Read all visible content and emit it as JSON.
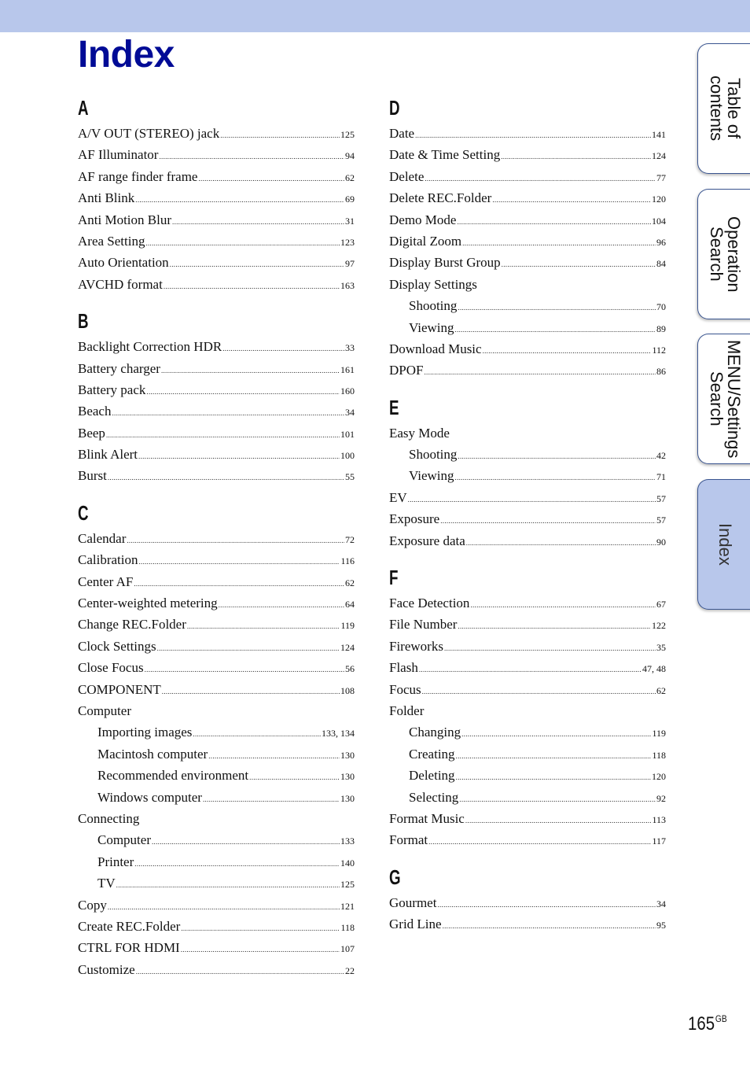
{
  "page": {
    "title": "Index",
    "page_number": "165",
    "page_suffix": "GB"
  },
  "tabs": [
    {
      "label": "Table of\ncontents",
      "active": false
    },
    {
      "label": "Operation\nSearch",
      "active": false
    },
    {
      "label": "MENU/Settings\nSearch",
      "active": false
    },
    {
      "label": "Index",
      "active": true
    }
  ],
  "left_column": [
    {
      "letter": "A",
      "entries": [
        {
          "label": "A/V OUT (STEREO) jack",
          "page": "125"
        },
        {
          "label": "AF Illuminator",
          "page": "94"
        },
        {
          "label": "AF range finder frame",
          "page": "62"
        },
        {
          "label": "Anti Blink",
          "page": "69"
        },
        {
          "label": "Anti Motion Blur",
          "page": "31"
        },
        {
          "label": "Area Setting",
          "page": "123"
        },
        {
          "label": "Auto Orientation",
          "page": "97"
        },
        {
          "label": "AVCHD format",
          "page": "163"
        }
      ]
    },
    {
      "letter": "B",
      "entries": [
        {
          "label": "Backlight Correction HDR",
          "page": "33"
        },
        {
          "label": "Battery charger",
          "page": "161"
        },
        {
          "label": "Battery pack",
          "page": "160"
        },
        {
          "label": "Beach",
          "page": "34"
        },
        {
          "label": "Beep",
          "page": "101"
        },
        {
          "label": "Blink Alert",
          "page": "100"
        },
        {
          "label": "Burst",
          "page": "55"
        }
      ]
    },
    {
      "letter": "C",
      "entries": [
        {
          "label": "Calendar",
          "page": "72"
        },
        {
          "label": "Calibration",
          "page": "116"
        },
        {
          "label": "Center AF",
          "page": "62"
        },
        {
          "label": "Center-weighted metering",
          "page": "64"
        },
        {
          "label": "Change REC.Folder",
          "page": "119"
        },
        {
          "label": "Clock Settings",
          "page": "124"
        },
        {
          "label": "Close Focus",
          "page": "56"
        },
        {
          "label": "COMPONENT",
          "page": "108"
        },
        {
          "label": "Computer",
          "page": ""
        },
        {
          "label": "Importing images",
          "page": "133, 134",
          "sub": true
        },
        {
          "label": "Macintosh computer",
          "page": "130",
          "sub": true
        },
        {
          "label": "Recommended environment",
          "page": "130",
          "sub": true
        },
        {
          "label": "Windows computer",
          "page": "130",
          "sub": true
        },
        {
          "label": "Connecting",
          "page": ""
        },
        {
          "label": "Computer",
          "page": "133",
          "sub": true
        },
        {
          "label": "Printer",
          "page": "140",
          "sub": true
        },
        {
          "label": "TV",
          "page": "125",
          "sub": true
        },
        {
          "label": "Copy",
          "page": "121"
        },
        {
          "label": "Create REC.Folder",
          "page": "118"
        },
        {
          "label": "CTRL FOR HDMI",
          "page": "107"
        },
        {
          "label": "Customize",
          "page": "22"
        }
      ]
    }
  ],
  "right_column": [
    {
      "letter": "D",
      "entries": [
        {
          "label": "Date",
          "page": "141"
        },
        {
          "label": "Date & Time Setting",
          "page": "124"
        },
        {
          "label": "Delete",
          "page": "77"
        },
        {
          "label": "Delete REC.Folder",
          "page": "120"
        },
        {
          "label": "Demo Mode",
          "page": "104"
        },
        {
          "label": "Digital Zoom",
          "page": "96"
        },
        {
          "label": "Display Burst Group",
          "page": "84"
        },
        {
          "label": "Display Settings",
          "page": ""
        },
        {
          "label": "Shooting",
          "page": "70",
          "sub": true
        },
        {
          "label": "Viewing",
          "page": "89",
          "sub": true
        },
        {
          "label": "Download Music",
          "page": "112"
        },
        {
          "label": "DPOF",
          "page": "86"
        }
      ]
    },
    {
      "letter": "E",
      "entries": [
        {
          "label": "Easy Mode",
          "page": ""
        },
        {
          "label": "Shooting",
          "page": "42",
          "sub": true
        },
        {
          "label": "Viewing",
          "page": "71",
          "sub": true
        },
        {
          "label": "EV",
          "page": "57"
        },
        {
          "label": "Exposure",
          "page": "57"
        },
        {
          "label": "Exposure data",
          "page": "90"
        }
      ]
    },
    {
      "letter": "F",
      "entries": [
        {
          "label": "Face Detection",
          "page": "67"
        },
        {
          "label": "File Number",
          "page": "122"
        },
        {
          "label": "Fireworks",
          "page": "35"
        },
        {
          "label": "Flash",
          "page": "47, 48"
        },
        {
          "label": "Focus",
          "page": "62"
        },
        {
          "label": "Folder",
          "page": ""
        },
        {
          "label": "Changing",
          "page": "119",
          "sub": true
        },
        {
          "label": "Creating",
          "page": "118",
          "sub": true
        },
        {
          "label": "Deleting",
          "page": "120",
          "sub": true
        },
        {
          "label": "Selecting",
          "page": "92",
          "sub": true
        },
        {
          "label": "Format Music",
          "page": "113"
        },
        {
          "label": "Format",
          "page": "117"
        }
      ]
    },
    {
      "letter": "G",
      "entries": [
        {
          "label": "Gourmet",
          "page": "34"
        },
        {
          "label": "Grid Line",
          "page": "95"
        }
      ]
    }
  ]
}
